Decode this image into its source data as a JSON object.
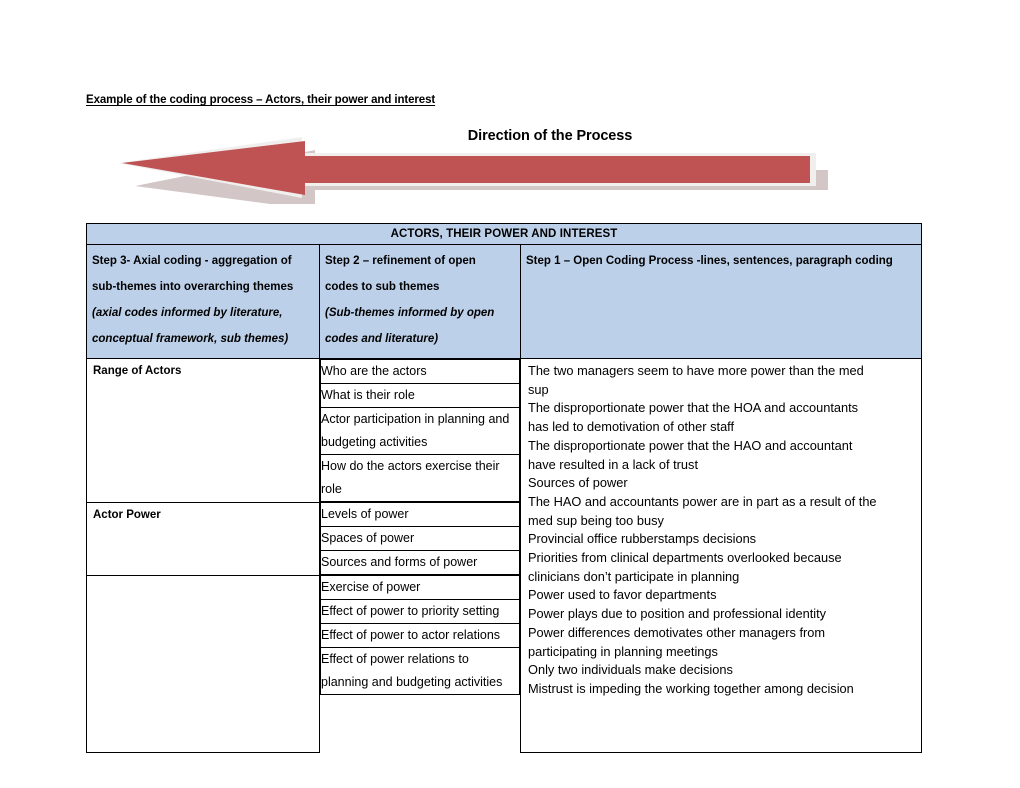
{
  "document": {
    "title": "Example of the coding process – Actors, their power and interest"
  },
  "diagram": {
    "heading": "Direction of the Process",
    "arrow_direction": "left",
    "arrow_color": "#bf5252",
    "arrow_shadow_color": "#d3c6c6",
    "arrow_outline_color": "#f1eeee"
  },
  "table": {
    "banner": "ACTORS, THEIR POWER AND INTEREST",
    "headers": [
      {
        "lines": [
          {
            "text": "Step 3- Axial coding - aggregation of",
            "italic": false
          },
          {
            "text": "sub-themes into overarching themes",
            "italic": false
          },
          {
            "text": "(axial codes informed by literature,",
            "italic": true
          },
          {
            "text": "conceptual framework, sub themes)",
            "italic": true
          }
        ]
      },
      {
        "lines": [
          {
            "text": "Step 2 – refinement of open",
            "italic": false
          },
          {
            "text": "codes to sub themes",
            "italic": false
          },
          {
            "text": "(Sub-themes informed by open",
            "italic": true
          },
          {
            "text": "codes and literature)",
            "italic": true
          }
        ]
      },
      {
        "lines": [
          {
            "text": "Step 1 – Open Coding Process -lines, sentences, paragraph coding",
            "italic": false
          }
        ]
      }
    ],
    "rows": [
      {
        "theme": "Range of Actors",
        "sub_themes": [
          "Who are the actors",
          "What is their role",
          "Actor participation in planning and budgeting activities",
          "How do the actors exercise their role"
        ]
      },
      {
        "theme": "Actor Power",
        "sub_themes": [
          "Levels of power",
          "Spaces of power",
          "Sources and forms of power"
        ]
      },
      {
        "theme": "",
        "sub_themes": [
          "Exercise of power",
          "Effect of power to priority setting",
          "Effect of power to actor relations",
          "Effect of power relations to planning and budgeting activities"
        ]
      }
    ],
    "open_codes": [
      "The two managers seem to have more power than the med",
      "sup",
      "The disproportionate power that the HOA and accountants",
      "has led to demotivation of other staff",
      "The disproportionate power that the HAO and accountant",
      "have resulted in a lack of trust",
      "Sources of power",
      "The HAO and accountants power are in part as a result of the",
      "med sup being too busy",
      "Provincial office rubberstamps decisions",
      "Priorities from clinical departments overlooked because",
      "clinicians don’t participate in planning",
      "Power used to favor departments",
      "Power plays due to position and professional identity",
      "Power differences demotivates other managers from",
      "participating in planning meetings",
      "Only two individuals make decisions",
      "Mistrust is impeding the working together among decision"
    ]
  }
}
